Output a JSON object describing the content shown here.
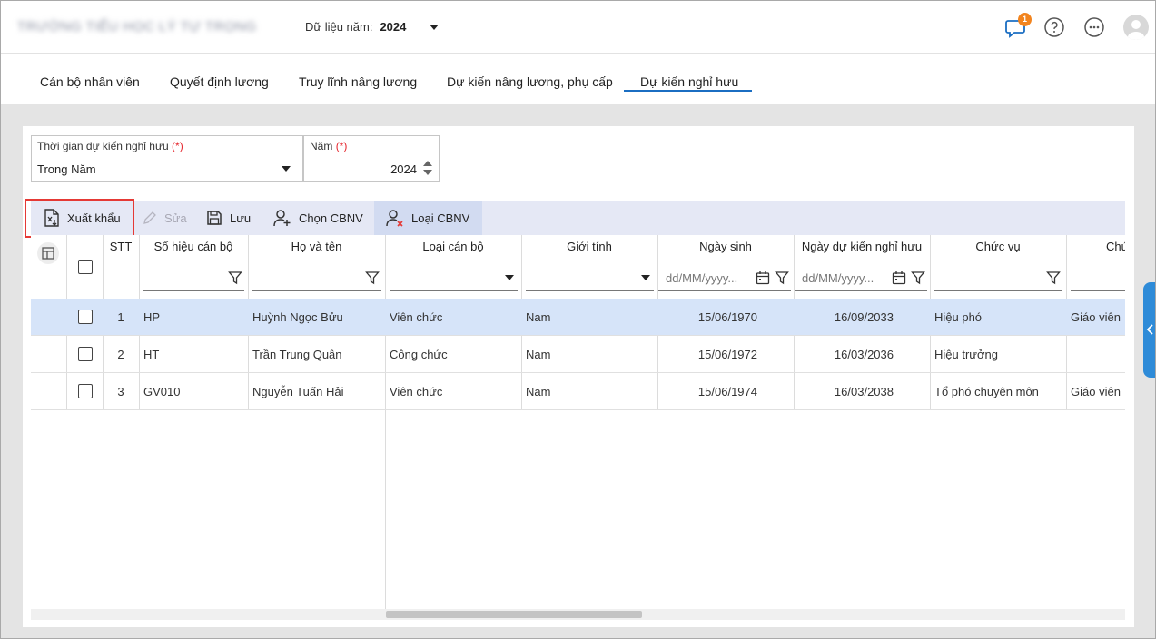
{
  "header": {
    "school_name": "TRƯỜNG TIỂU HỌC LÝ TỰ TRỌNG",
    "year_label": "Dữ liệu năm:",
    "year_value": "2024",
    "notification_count": "1"
  },
  "tabs": [
    {
      "label": "Cán bộ nhân viên"
    },
    {
      "label": "Quyết định lương"
    },
    {
      "label": "Truy lĩnh nâng lương"
    },
    {
      "label": "Dự kiến nâng lương, phụ cấp"
    },
    {
      "label": "Dự kiến nghỉ hưu",
      "active": true
    }
  ],
  "filters": {
    "period": {
      "label": "Thời gian dự kiến nghỉ hưu",
      "required": "(*)",
      "value": "Trong Năm"
    },
    "year": {
      "label": "Năm",
      "required": "(*)",
      "value": "2024"
    }
  },
  "toolbar": {
    "export": "Xuất khẩu",
    "edit": "Sửa",
    "save": "Lưu",
    "choose": "Chọn CBNV",
    "remove": "Loại CBNV"
  },
  "grid": {
    "columns": [
      {
        "label": "STT"
      },
      {
        "label": "Số hiệu cán bộ"
      },
      {
        "label": "Họ và tên"
      },
      {
        "label": "Loại cán bộ"
      },
      {
        "label": "Giới tính"
      },
      {
        "label": "Ngày sinh"
      },
      {
        "label": "Ngày dự kiến nghỉ hưu"
      },
      {
        "label": "Chức vụ"
      },
      {
        "label": "Chứ"
      }
    ],
    "date_placeholder": "dd/MM/yyyy...",
    "rows": [
      {
        "stt": "1",
        "code": "HP",
        "name": "Huỳnh Ngọc Bửu",
        "type": "Viên chức",
        "gender": "Nam",
        "dob": "15/06/1970",
        "retire": "16/09/2033",
        "position": "Hiệu phó",
        "extra": "Giáo viên"
      },
      {
        "stt": "2",
        "code": "HT",
        "name": "Trần Trung Quân",
        "type": "Công chức",
        "gender": "Nam",
        "dob": "15/06/1972",
        "retire": "16/03/2036",
        "position": "Hiệu trưởng",
        "extra": ""
      },
      {
        "stt": "3",
        "code": "GV010",
        "name": "Nguyễn Tuấn Hải",
        "type": "Viên chức",
        "gender": "Nam",
        "dob": "15/06/1974",
        "retire": "16/03/2038",
        "position": "Tổ phó chuyên môn",
        "extra": "Giáo viên"
      }
    ]
  },
  "colors": {
    "accent": "#1b6ec2",
    "toolbar_bg": "#e5e8f5",
    "selected_row": "#d6e4f9",
    "highlight": "#e53935",
    "badge": "#f2841e"
  }
}
